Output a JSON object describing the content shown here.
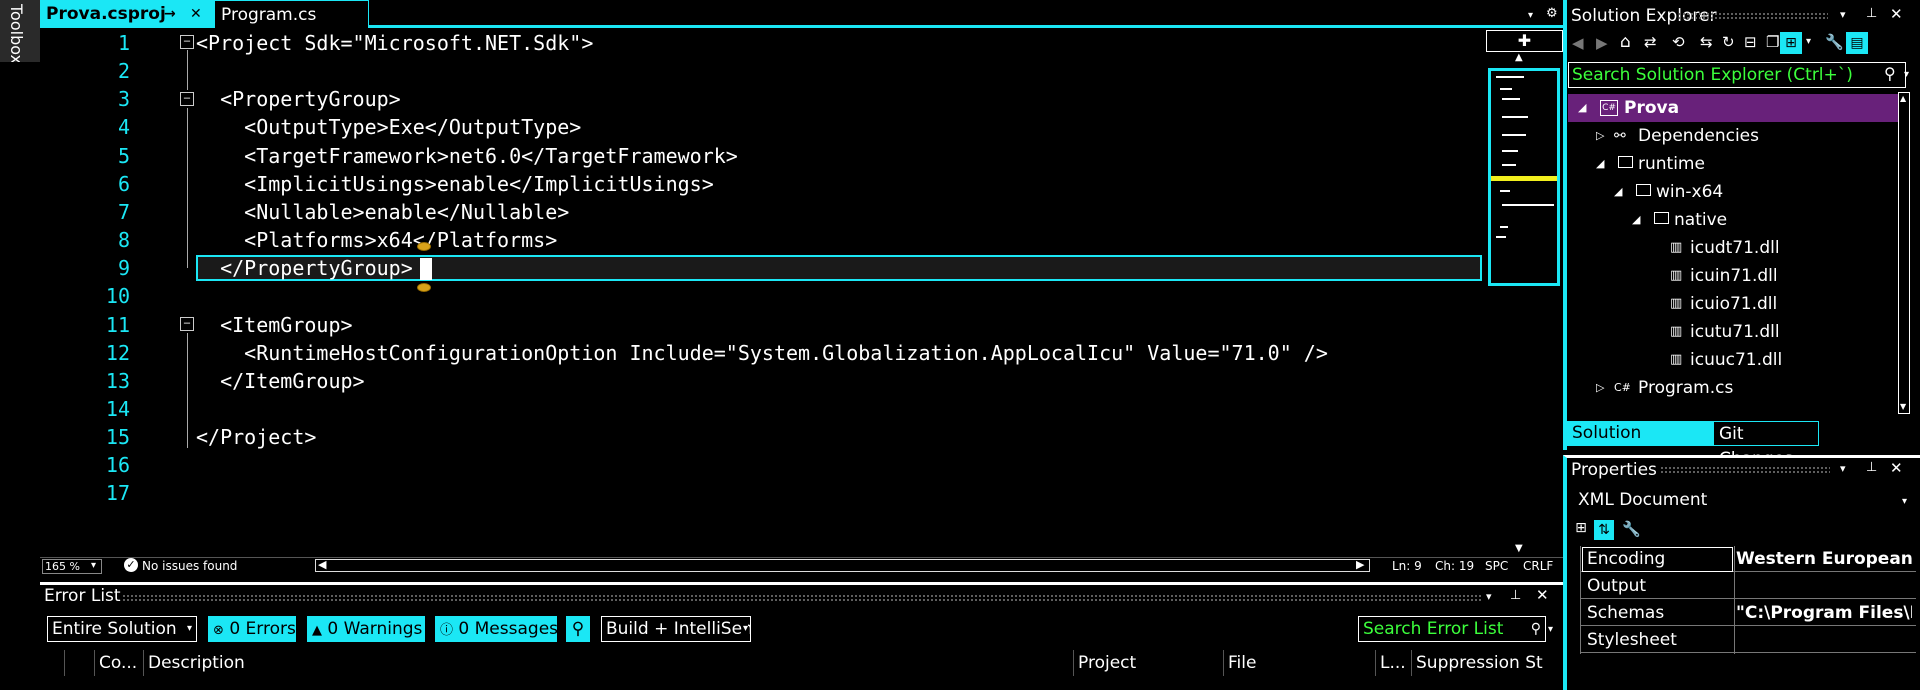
{
  "toolbox": {
    "label": "Toolbox"
  },
  "tabs": [
    {
      "label": "Prova.csproj",
      "active": true,
      "pin": "→",
      "close": "✕"
    },
    {
      "label": "Program.cs",
      "active": false
    }
  ],
  "editor": {
    "lines": [
      {
        "n": "1",
        "text": "<Project Sdk=\"Microsoft.NET.Sdk\">"
      },
      {
        "n": "2",
        "text": ""
      },
      {
        "n": "3",
        "text": "  <PropertyGroup>"
      },
      {
        "n": "4",
        "text": "    <OutputType>Exe</OutputType>"
      },
      {
        "n": "5",
        "text": "    <TargetFramework>net6.0</TargetFramework>"
      },
      {
        "n": "6",
        "text": "    <ImplicitUsings>enable</ImplicitUsings>"
      },
      {
        "n": "7",
        "text": "    <Nullable>enable</Nullable>"
      },
      {
        "n": "8",
        "text": "    <Platforms>x64</Platforms>"
      },
      {
        "n": "9",
        "text": "  </PropertyGroup>"
      },
      {
        "n": "10",
        "text": ""
      },
      {
        "n": "11",
        "text": "  <ItemGroup>"
      },
      {
        "n": "12",
        "text": "    <RuntimeHostConfigurationOption Include=\"System.Globalization.AppLocalIcu\" Value=\"71.0\" />"
      },
      {
        "n": "13",
        "text": "  </ItemGroup>"
      },
      {
        "n": "14",
        "text": ""
      },
      {
        "n": "15",
        "text": "</Project>"
      },
      {
        "n": "16",
        "text": ""
      },
      {
        "n": "17",
        "text": ""
      }
    ],
    "fold_symbol": "−"
  },
  "status": {
    "zoom": "165 %",
    "issues": "No issues found",
    "ln": "Ln: 9",
    "ch": "Ch: 19",
    "spc": "SPC",
    "crlf": "CRLF"
  },
  "error_list": {
    "title": "Error List",
    "scope": "Entire Solution",
    "errors": "0 Errors",
    "warnings": "0 Warnings",
    "messages": "0 Messages",
    "build_filter": "Build + IntelliSen",
    "search_placeholder": "Search Error List",
    "columns": [
      "Co...",
      "Description",
      "Project",
      "File",
      "L...",
      "Suppression St"
    ]
  },
  "solution_explorer": {
    "title": "Solution Explorer",
    "search_placeholder": "Search Solution Explorer (Ctrl+`)",
    "project": "Prova",
    "project_icon": "C#",
    "items": [
      {
        "label": "Dependencies",
        "icon": "dependencies-icon"
      },
      {
        "label": "runtime",
        "icon": "folder-icon"
      },
      {
        "label": "win-x64",
        "icon": "folder-icon"
      },
      {
        "label": "native",
        "icon": "folder-icon"
      },
      {
        "label": "icudt71.dll",
        "icon": "dll-icon"
      },
      {
        "label": "icuin71.dll",
        "icon": "dll-icon"
      },
      {
        "label": "icuio71.dll",
        "icon": "dll-icon"
      },
      {
        "label": "icutu71.dll",
        "icon": "dll-icon"
      },
      {
        "label": "icuuc71.dll",
        "icon": "dll-icon"
      },
      {
        "label": "Program.cs",
        "icon": "csharp-file-icon",
        "prefix": "C#"
      }
    ],
    "tabs": [
      "Solution Explorer",
      "Git Changes"
    ]
  },
  "properties": {
    "title": "Properties",
    "object": "XML Document",
    "rows": [
      {
        "name": "Encoding",
        "value": "Western European (W"
      },
      {
        "name": "Output",
        "value": ""
      },
      {
        "name": "Schemas",
        "value": "\"C:\\Program Files\\M"
      },
      {
        "name": "Stylesheet",
        "value": ""
      }
    ]
  },
  "colors": {
    "accent": "#1be7f5",
    "selection": "#68217a",
    "search_text": "#3cff3c",
    "highlight": "#f2ef1d"
  }
}
